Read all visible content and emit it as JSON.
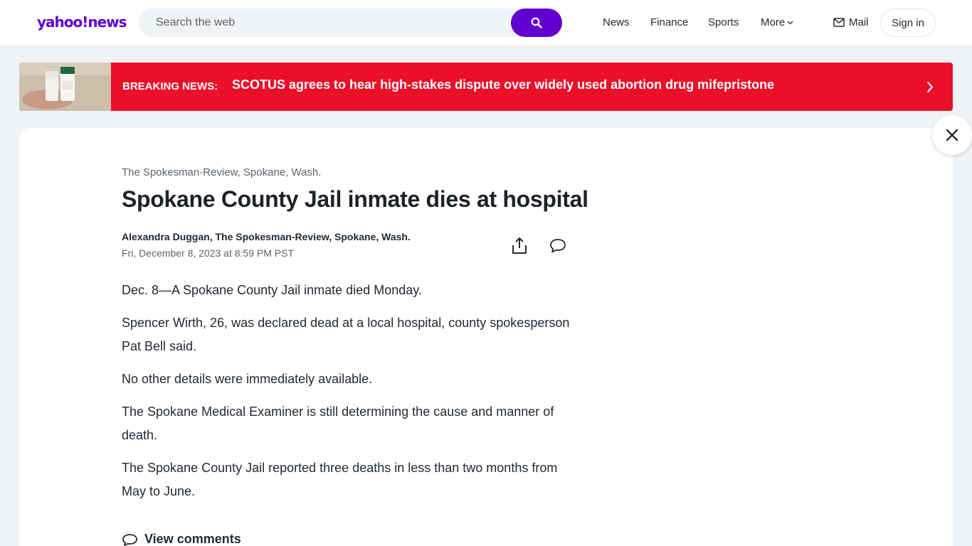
{
  "header": {
    "logo": "yahoo!news",
    "search_placeholder": "Search the web",
    "nav": [
      "News",
      "Finance",
      "Sports",
      "More"
    ],
    "mail_label": "Mail",
    "signin_label": "Sign in"
  },
  "breaking": {
    "label": "BREAKING NEWS:",
    "headline": "SCOTUS agrees to hear high-stakes dispute over widely used abortion drug mifepristone"
  },
  "article": {
    "provider": "The Spokesman-Review, Spokane, Wash.",
    "title": "Spokane County Jail inmate dies at hospital",
    "author": "Alexandra Duggan, The Spokesman-Review, Spokane, Wash.",
    "date": "Fri, December 8, 2023 at 8:59 PM PST",
    "paragraphs": [
      "Dec. 8—A Spokane County Jail inmate died Monday.",
      "Spencer Wirth, 26, was declared dead at a local hospital, county spokesperson Pat Bell said.",
      "No other details were immediately available.",
      "The Spokane Medical Examiner is still determining the cause and manner of death.",
      "The Spokane County Jail reported three deaths in less than two months from May to June."
    ],
    "view_comments_label": "View comments"
  },
  "colors": {
    "brand_purple": "#6001d2",
    "breaking_red": "#eb0f29",
    "page_bg": "#f0f3f5"
  },
  "icons": {
    "search": "search-icon",
    "mail": "mail-icon",
    "chevron": "chevron-right-icon",
    "close": "close-icon",
    "share": "share-icon",
    "comment": "comment-icon"
  }
}
